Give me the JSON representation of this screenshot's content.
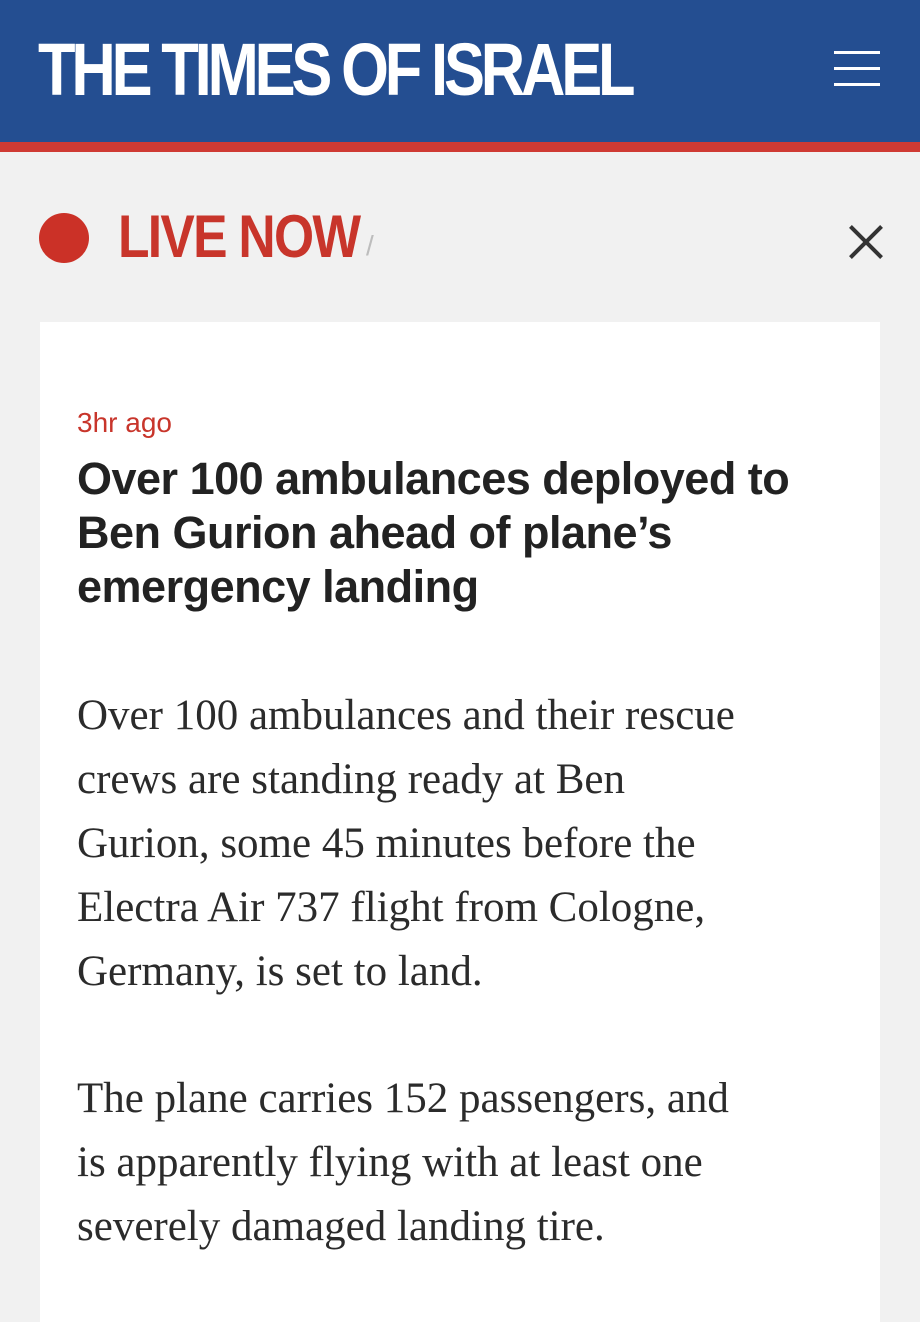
{
  "header": {
    "logo_text": "THE TIMES OF ISRAEL",
    "menu_icon": "hamburger-menu-icon",
    "brand_color": "#244e91",
    "accent_color": "#cf3a33"
  },
  "live": {
    "label": "LIVE NOW",
    "separator": "/",
    "dot_icon": "live-dot-icon",
    "close_icon": "close-icon"
  },
  "article": {
    "timestamp": "3hr ago",
    "headline_lines": [
      "Over 100 ambulances deployed to",
      "Ben Gurion ahead of plane’s",
      "emergency landing"
    ],
    "paragraphs": [
      {
        "lines": [
          "Over 100 ambulances and their rescue",
          "crews are standing ready at Ben",
          "Gurion, some 45 minutes before the",
          "Electra Air 737 flight from Cologne,",
          "Germany, is set to land."
        ]
      },
      {
        "lines": [
          "The plane carries 152 passengers, and",
          "is apparently flying with at least one",
          "severely damaged landing tire."
        ]
      }
    ]
  }
}
